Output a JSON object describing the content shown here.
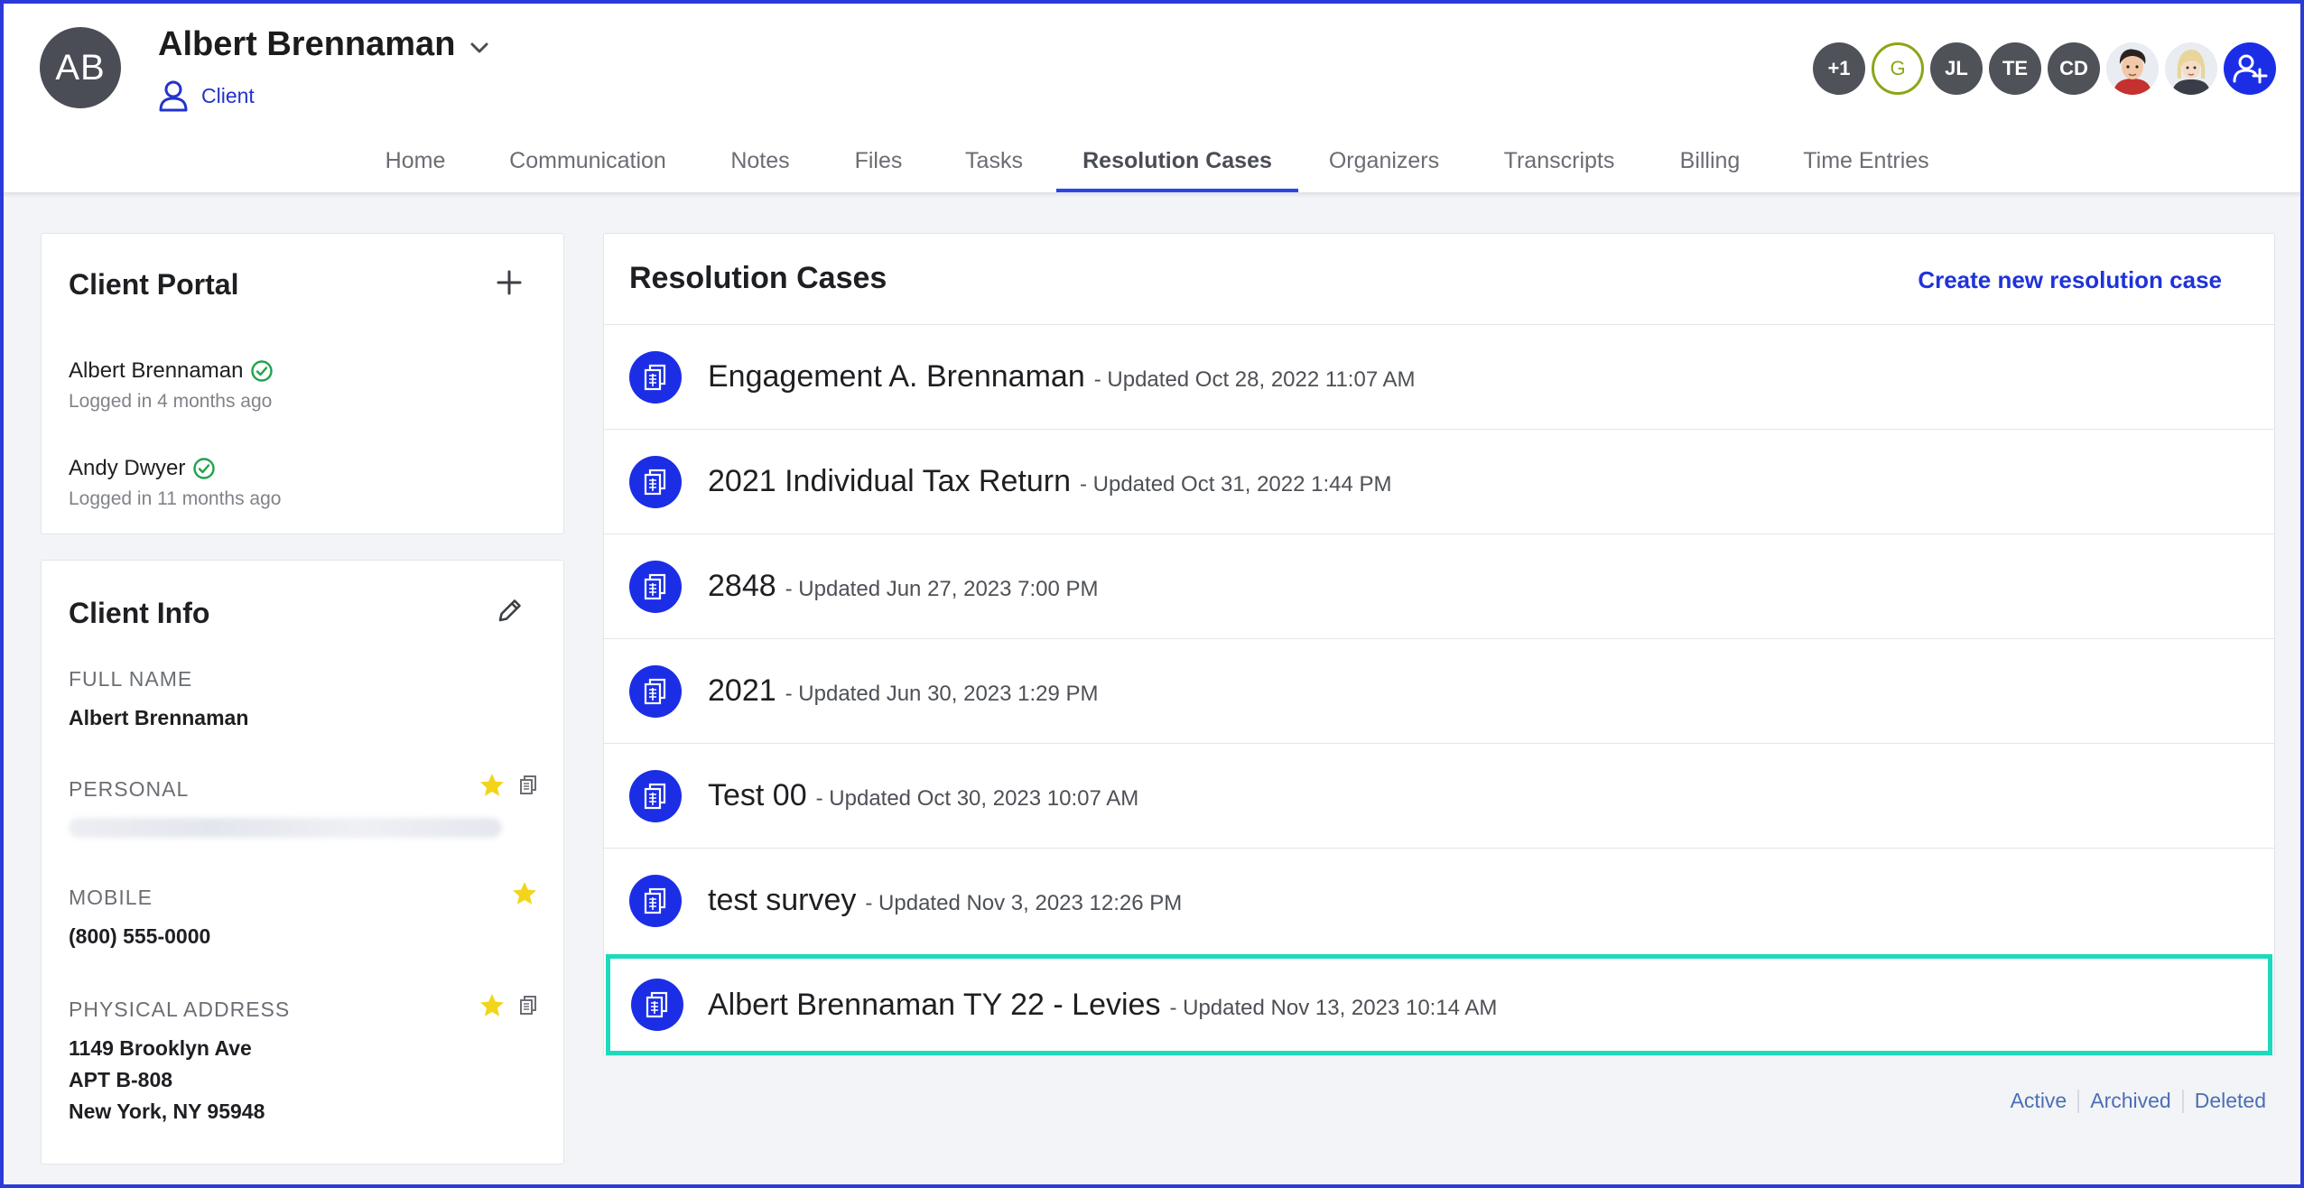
{
  "client": {
    "initials": "AB",
    "name": "Albert Brennaman",
    "type": "Client"
  },
  "tabs": [
    {
      "label": "Home"
    },
    {
      "label": "Communication"
    },
    {
      "label": "Notes"
    },
    {
      "label": "Files"
    },
    {
      "label": "Tasks"
    },
    {
      "label": "Resolution Cases",
      "active": true
    },
    {
      "label": "Organizers"
    },
    {
      "label": "Transcripts"
    },
    {
      "label": "Billing"
    },
    {
      "label": "Time Entries"
    }
  ],
  "team": {
    "more": "+1",
    "members": [
      "G",
      "JL",
      "TE",
      "CD"
    ],
    "add_icon": "add-user-icon"
  },
  "portal": {
    "title": "Client Portal",
    "users": [
      {
        "name": "Albert Brennaman",
        "login": "Logged in 4 months ago"
      },
      {
        "name": "Andy Dwyer",
        "login": "Logged in 11 months ago"
      }
    ]
  },
  "info": {
    "title": "Client Info",
    "full_name_label": "FULL NAME",
    "full_name": "Albert Brennaman",
    "personal_label": "PERSONAL",
    "mobile_label": "MOBILE",
    "mobile": "(800) 555-0000",
    "address_label": "PHYSICAL ADDRESS",
    "address_line1": "1149 Brooklyn Ave",
    "address_line2": "APT B-808",
    "address_line3": "New York, NY 95948"
  },
  "cases": {
    "title": "Resolution Cases",
    "create_label": "Create new resolution case",
    "items": [
      {
        "name": "Engagement A. Brennaman",
        "updated": "- Updated Oct 28, 2022 11:07 AM"
      },
      {
        "name": "2021 Individual Tax Return",
        "updated": "- Updated Oct 31, 2022 1:44 PM"
      },
      {
        "name": "2848",
        "updated": "- Updated Jun 27, 2023 7:00 PM"
      },
      {
        "name": "2021",
        "updated": "- Updated Jun 30, 2023 1:29 PM"
      },
      {
        "name": "Test 00",
        "updated": "- Updated Oct 30, 2023 10:07 AM"
      },
      {
        "name": "test survey",
        "updated": "- Updated Nov 3, 2023 12:26 PM"
      },
      {
        "name": "Albert Brennaman TY 22 - Levies",
        "updated": "- Updated Nov 13, 2023 10:14 AM"
      }
    ],
    "filters": [
      "Active",
      "Archived",
      "Deleted"
    ]
  },
  "colors": {
    "accent": "#1b2ee6",
    "highlight": "#1ed9bd",
    "star": "#f2d51b",
    "verified": "#1fa34a"
  }
}
